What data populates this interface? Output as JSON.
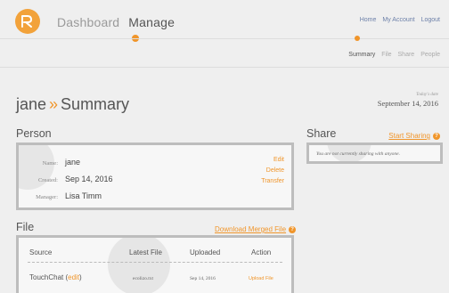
{
  "nav": {
    "main": [
      "Dashboard",
      "Manage"
    ],
    "active_main": "Manage",
    "util": [
      "Home",
      "My Account",
      "Logout"
    ],
    "sub": [
      "Summary",
      "File",
      "Share",
      "People"
    ],
    "active_sub": "Summary"
  },
  "page": {
    "user": "jane",
    "separator": "»",
    "section": "Summary",
    "today_label": "Today's date",
    "today_value": "September 14, 2016"
  },
  "person": {
    "title": "Person",
    "fields": [
      {
        "label": "Name:",
        "value": "jane"
      },
      {
        "label": "Created:",
        "value": "Sep 14, 2016"
      },
      {
        "label": "Manager:",
        "value": "Lisa Timm"
      }
    ],
    "actions": [
      "Edit",
      "Delete",
      "Transfer"
    ]
  },
  "share": {
    "title": "Share",
    "link": "Start Sharing",
    "message": "You are not currently sharing with anyone."
  },
  "file": {
    "title": "File",
    "link": "Download Merged File",
    "columns": [
      "Source",
      "Latest File",
      "Uploaded",
      "Action"
    ],
    "rows": [
      {
        "source": "TouchChat",
        "edit": "edit",
        "latest": "ecolizo.txt",
        "uploaded": "Sep 14, 2016",
        "action": "Upload File"
      }
    ]
  },
  "colors": {
    "accent": "#f0952a",
    "link_blue": "#6b7fa8",
    "panel_border": "#bdbdbd",
    "background": "#efefef"
  },
  "icons": {
    "logo": "logo-icon",
    "help": "help-icon"
  }
}
